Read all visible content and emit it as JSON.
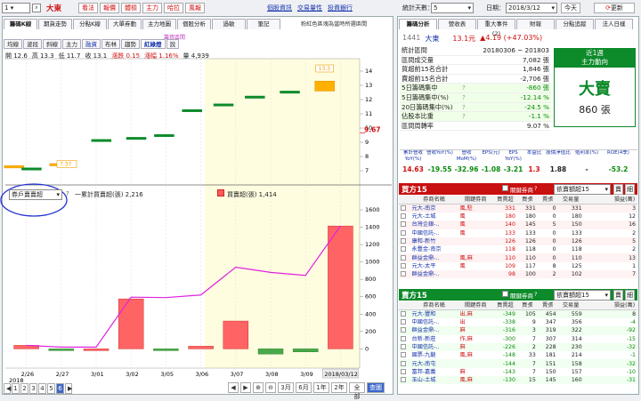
{
  "top": {
    "stock_no": "1",
    "stock_name": "大東",
    "buttons": [
      "看法",
      "報價",
      "體檢",
      "主力",
      "哈拉",
      "風報"
    ],
    "links": [
      "個股資訊",
      "交易量性",
      "投資銀行"
    ],
    "days_label": "統計天數：",
    "days_value": "5",
    "date_label": "日期：",
    "date_value": "2018/3/12",
    "today": "今天",
    "refresh": "更新"
  },
  "left_tabs": [
    "籌碼K線",
    "期貨走勢",
    "分點K線",
    "大單券動",
    "主力地圖",
    "個股分析",
    "過敏",
    "筆記"
  ],
  "chip_hint": "粉紅色區塊為當時所選區間",
  "sub_tabs": [
    "均線",
    "波段",
    "斜線",
    "主力",
    "融資",
    "布林",
    "趨勢",
    "紅綠燈",
    "說"
  ],
  "range_label": "籌資區間",
  "ohlc": {
    "o": "開 12.6",
    "h": "高 13.3",
    "l": "低 11.7",
    "c": "收 13.1",
    "chg": "漲跌 0.15",
    "pct": "漲幅 1.16%",
    "vol": "量 4,939"
  },
  "lower": {
    "select": "券戶賣賣超",
    "q": "?",
    "legend1": "一累計買賣超(張) 2,216",
    "legend2": "買賣超(張) 1,414"
  },
  "chart_data": [
    {
      "type": "bar",
      "title": "",
      "ylim": [
        6.5,
        14.5
      ],
      "yticks": [
        "14",
        "13",
        "12",
        "11",
        "10",
        "9",
        "8",
        "7"
      ],
      "price_label": "9.67",
      "hi_label": "13.3",
      "lo_label": "7.37",
      "candles": [
        {
          "x": 0.02,
          "o": 7.25,
          "c": 7.35
        },
        {
          "x": 0.07,
          "o": 7.2,
          "c": 7.2
        },
        {
          "x": 0.15,
          "o": 7.4,
          "c": 7.5
        },
        {
          "x": 0.27,
          "o": 9.2,
          "c": 9.2
        },
        {
          "x": 0.37,
          "o": 9.35,
          "c": 9.35
        },
        {
          "x": 0.45,
          "o": 9.55,
          "c": 9.55
        },
        {
          "x": 0.53,
          "o": 11.3,
          "c": 11.3
        },
        {
          "x": 0.62,
          "o": 11.7,
          "c": 11.7
        },
        {
          "x": 0.71,
          "o": 12.25,
          "c": 12.25
        },
        {
          "x": 0.81,
          "o": 12.6,
          "c": 12.6
        },
        {
          "x": 0.91,
          "o": 12.6,
          "c": 13.3
        }
      ]
    },
    {
      "type": "bar",
      "title": "",
      "ylim": [
        -150,
        1600
      ],
      "yticks": [
        "1600",
        "1400",
        "1200",
        "1000",
        "800",
        "600",
        "400",
        "200",
        "0"
      ],
      "dates": [
        "2/26",
        "2/27",
        "3/01",
        "3/02",
        "3/05",
        "3/06",
        "3/07",
        "3/08",
        "3/09",
        "2018/03/12"
      ],
      "year": "2018",
      "bars": [
        40,
        -20,
        0,
        575,
        -5,
        30,
        320,
        -60,
        -35,
        1414
      ],
      "line": [
        40,
        20,
        20,
        595,
        590,
        620,
        940,
        880,
        845,
        1414
      ]
    }
  ],
  "pages": [
    "1",
    "2",
    "3",
    "4",
    "5",
    "6"
  ],
  "zoom": [
    "3月",
    "6月",
    "1年",
    "2年",
    "全部",
    "查圖"
  ],
  "right_tabs": [
    "籌碼分析",
    "營收表",
    "重大事件(2)",
    "財報",
    "分點追蹤",
    "法人日樣"
  ],
  "stock": {
    "code": "1441",
    "name": "大東",
    "price": "13.1元",
    "change": "▲4.19 (+47.03%)"
  },
  "stats": [
    {
      "label": "統計區間",
      "value": "20180306 ~ 201803",
      "cls": ""
    },
    {
      "label": "區間成交量",
      "value": "7,082 張",
      "cls": ""
    },
    {
      "label": "買超前15名合計",
      "value": "1,846 張",
      "cls": ""
    },
    {
      "label": "賣超前15名合計",
      "value": "-2,706 張",
      "cls": ""
    },
    {
      "label": "5日籌碼集中",
      "value": "-860 張",
      "cls": "green"
    },
    {
      "label": "5日籌碼集中(%)",
      "value": "-12.14 %",
      "cls": "green"
    },
    {
      "label": "20日籌碼集中(%)",
      "value": "-24.5 %",
      "cls": "green"
    },
    {
      "label": "佔股本比重",
      "value": "-1.1 %",
      "cls": "green"
    },
    {
      "label": "區間周轉率",
      "value": "9.07 %",
      "cls": ""
    }
  ],
  "main_force": {
    "period": "近1週",
    "title": "主力動向",
    "verdict": "大賣",
    "amount": "860 張"
  },
  "fin_headers": [
    "累計營收YoY(%)",
    "營收YoY(%)",
    "營收MoM(%)",
    "EPS(元)",
    "EPS YoY(%)",
    "本益比",
    "股價淨值比",
    "殖利率(%)",
    "ROE(4季)"
  ],
  "fin_values": [
    {
      "v": "14.63",
      "c": "red"
    },
    {
      "v": "-19.55",
      "c": "green"
    },
    {
      "v": "-32.96",
      "c": "green"
    },
    {
      "v": "-1.08",
      "c": "green"
    },
    {
      "v": "-3.21",
      "c": "green"
    },
    {
      "v": "1.3",
      "c": "red"
    },
    {
      "v": "1.88",
      "c": ""
    },
    {
      "v": "-",
      "c": ""
    },
    {
      "v": "-53.2",
      "c": "green"
    }
  ],
  "buy": {
    "title": "買方15",
    "rel": "關鍵券商",
    "select": "依賣額超15",
    "b1": "賣",
    "b2": "細",
    "headers": [
      "",
      "券商名稱",
      "關鍵券商",
      "買賣超",
      "買張",
      "賣張",
      "交易量",
      "",
      "損益(萬)"
    ],
    "rows": [
      [
        "元大-南京",
        "風,駐",
        "331",
        "331",
        "0",
        "331",
        "3"
      ],
      [
        "元大-土城",
        "風",
        "180",
        "180",
        "0",
        "180",
        "12"
      ],
      [
        "台灣企銀-..",
        "風",
        "140",
        "145",
        "5",
        "150",
        "16"
      ],
      [
        "中國信託-..",
        "風",
        "133",
        "133",
        "0",
        "133",
        "2"
      ],
      [
        "康和-新竹",
        "",
        "126",
        "126",
        "0",
        "126",
        "5"
      ],
      [
        "永豐金-南京",
        "",
        "118",
        "118",
        "0",
        "118",
        "2"
      ],
      [
        "群益金鼎-..",
        "風,麻",
        "110",
        "110",
        "0",
        "110",
        "13"
      ],
      [
        "元大-太平",
        "風",
        "109",
        "117",
        "8",
        "125",
        "1"
      ],
      [
        "群益金鼎-..",
        "",
        "98",
        "100",
        "2",
        "102",
        "7"
      ]
    ]
  },
  "sell": {
    "title": "賣方15",
    "rel": "關鍵券商",
    "select": "依賣額超15",
    "b1": "賣",
    "b2": "細",
    "headers": [
      "",
      "券商名稱",
      "關鍵券商",
      "買賣超",
      "買張",
      "賣張",
      "交易量",
      "",
      "損益(萬)"
    ],
    "rows": [
      [
        "元大-豐和",
        "出,麻",
        "-349",
        "105",
        "454",
        "559",
        "8"
      ],
      [
        "中國信託-..",
        "出",
        "-338",
        "9",
        "347",
        "356",
        "-4"
      ],
      [
        "群益金鼎-..",
        "麻",
        "-316",
        "3",
        "319",
        "322",
        "-92"
      ],
      [
        "台新-新莊",
        "作,麻",
        "-300",
        "7",
        "307",
        "314",
        "-15"
      ],
      [
        "中國信託-..",
        "麻",
        "-226",
        "2",
        "228",
        "230",
        "-32"
      ],
      [
        "國票-九龍",
        "風,麻",
        "-148",
        "33",
        "181",
        "214",
        "-1"
      ],
      [
        "元大-南屯",
        "",
        "-144",
        "7",
        "151",
        "158",
        "-32"
      ],
      [
        "富邦-嘉義",
        "麻",
        "-143",
        "7",
        "150",
        "157",
        "-10"
      ],
      [
        "玉山-土城",
        "風,麻",
        "-130",
        "15",
        "145",
        "160",
        "-31"
      ]
    ]
  }
}
